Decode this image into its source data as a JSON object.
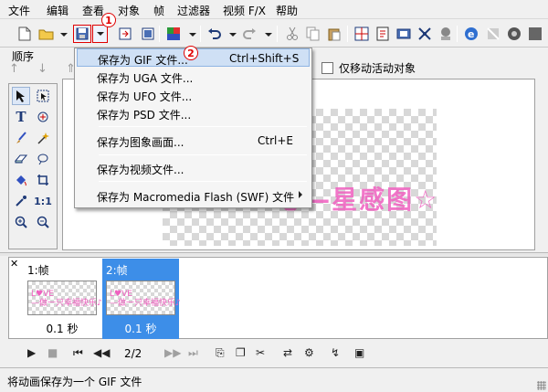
{
  "menubar": {
    "items": [
      "文件",
      "编辑",
      "查看",
      "对象",
      "帧",
      "过滤器",
      "视频 F/X",
      "帮助"
    ]
  },
  "toolbar": {
    "icons": [
      "new-icon",
      "open-icon",
      "save-icon",
      "import-icon",
      "export-icon",
      "color-icon",
      "undo-icon",
      "redo-icon",
      "cut-icon",
      "copy-icon",
      "paste-icon",
      "web-icon"
    ]
  },
  "panel": {
    "order_label": "顺序",
    "order_arrows": "↑ ↓ ⇑ ⇓"
  },
  "options": {
    "move_active_label": "仅移动活动对象"
  },
  "canvas": {
    "art_text": "♥—心—星感图☆"
  },
  "dropdown": {
    "items": [
      {
        "label": "保存为 GIF 文件...",
        "shortcut": "Ctrl+Shift+S"
      },
      {
        "label": "保存为 UGA 文件..."
      },
      {
        "label": "保存为 UFO 文件..."
      },
      {
        "label": "保存为 PSD 文件..."
      },
      {
        "label": "保存为图象画面...",
        "shortcut": "Ctrl+E"
      },
      {
        "label": "保存为视频文件..."
      },
      {
        "label": "保存为 Macromedia Flash (SWF) 文件"
      }
    ]
  },
  "callouts": {
    "step1": "1",
    "step2": "2"
  },
  "frames": [
    {
      "label": "1:帧",
      "duration": "0.1 秒",
      "thumb_text": "L♥VE\n—做一只幸福快乐♪"
    },
    {
      "label": "2:帧",
      "duration": "0.1 秒",
      "thumb_text": "L♥VE\n—做一只幸福快乐♪"
    }
  ],
  "playback": {
    "page": "2/2"
  },
  "status": {
    "text": "将动画保存为一个 GIF 文件"
  },
  "colors": {
    "highlight": "#cfe0f5",
    "callout": "#e00000",
    "frame_selected": "#3d8ee8"
  }
}
